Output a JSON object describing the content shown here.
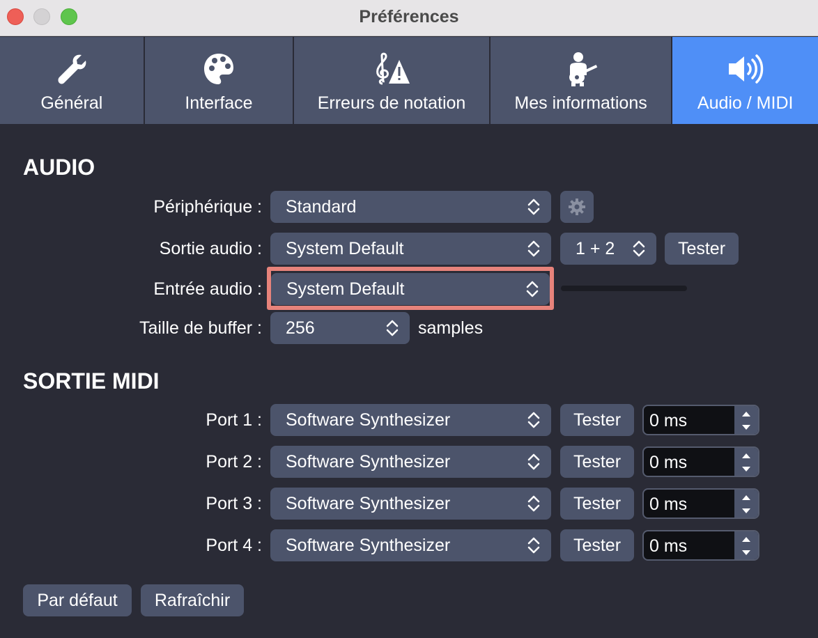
{
  "window": {
    "title": "Préférences"
  },
  "tabs": [
    {
      "label": "Général",
      "icon": "wrench-icon"
    },
    {
      "label": "Interface",
      "icon": "palette-icon"
    },
    {
      "label": "Erreurs de notation",
      "icon": "treble-clef-warning-icon"
    },
    {
      "label": "Mes informations",
      "icon": "guitar-player-icon"
    },
    {
      "label": "Audio / MIDI",
      "icon": "speaker-icon",
      "active": true
    }
  ],
  "audio": {
    "heading": "AUDIO",
    "device_label": "Périphérique :",
    "device_value": "Standard",
    "output_label": "Sortie audio :",
    "output_value": "System Default",
    "channels_value": "1 + 2",
    "test_label": "Tester",
    "input_label": "Entrée audio :",
    "input_value": "System Default",
    "input_level": 0,
    "buffer_label": "Taille de buffer :",
    "buffer_value": "256",
    "buffer_units": "samples"
  },
  "midi": {
    "heading": "SORTIE MIDI",
    "ports": [
      {
        "label": "Port 1 :",
        "value": "Software Synthesizer",
        "test": "Tester",
        "latency": "0 ms"
      },
      {
        "label": "Port 2 :",
        "value": "Software Synthesizer",
        "test": "Tester",
        "latency": "0 ms"
      },
      {
        "label": "Port 3 :",
        "value": "Software Synthesizer",
        "test": "Tester",
        "latency": "0 ms"
      },
      {
        "label": "Port 4 :",
        "value": "Software Synthesizer",
        "test": "Tester",
        "latency": "0 ms"
      }
    ]
  },
  "footer": {
    "default_label": "Par défaut",
    "refresh_label": "Rafraîchir"
  },
  "colors": {
    "accent": "#4f8ff7",
    "focus_ring": "#e7837b",
    "control_bg": "#4c546b",
    "window_bg": "#2a2b36"
  }
}
